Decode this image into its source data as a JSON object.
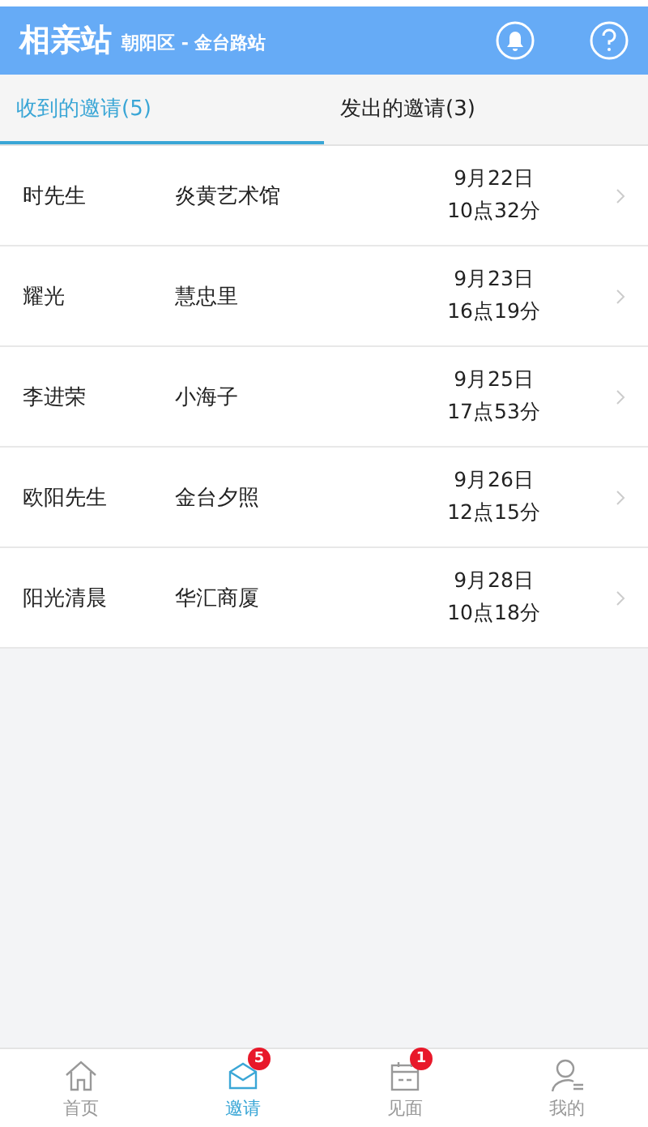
{
  "header": {
    "title": "相亲站",
    "location": "朝阳区 - 金台路站"
  },
  "tabs": [
    {
      "label": "收到的邀请(5)",
      "selected": true
    },
    {
      "label": "发出的邀请(3)",
      "selected": false
    }
  ],
  "invitations": [
    {
      "name": "时先生",
      "place": "炎黄艺术馆",
      "date": "9月22日",
      "time": "10点32分"
    },
    {
      "name": "耀光",
      "place": "慧忠里",
      "date": "9月23日",
      "time": "16点19分"
    },
    {
      "name": "李进荣",
      "place": "小海子",
      "date": "9月25日",
      "time": "17点53分"
    },
    {
      "name": "欧阳先生",
      "place": "金台夕照",
      "date": "9月26日",
      "time": "12点15分"
    },
    {
      "name": "阳光清晨",
      "place": "华汇商厦",
      "date": "9月28日",
      "time": "10点18分"
    }
  ],
  "bottom_nav": [
    {
      "kind": "home",
      "label": "首页",
      "selected": false
    },
    {
      "kind": "invite",
      "label": "邀请",
      "selected": true,
      "badge": "5"
    },
    {
      "kind": "meet",
      "label": "见面",
      "selected": false,
      "badge": "1"
    },
    {
      "kind": "me",
      "label": "我的",
      "selected": false
    }
  ]
}
